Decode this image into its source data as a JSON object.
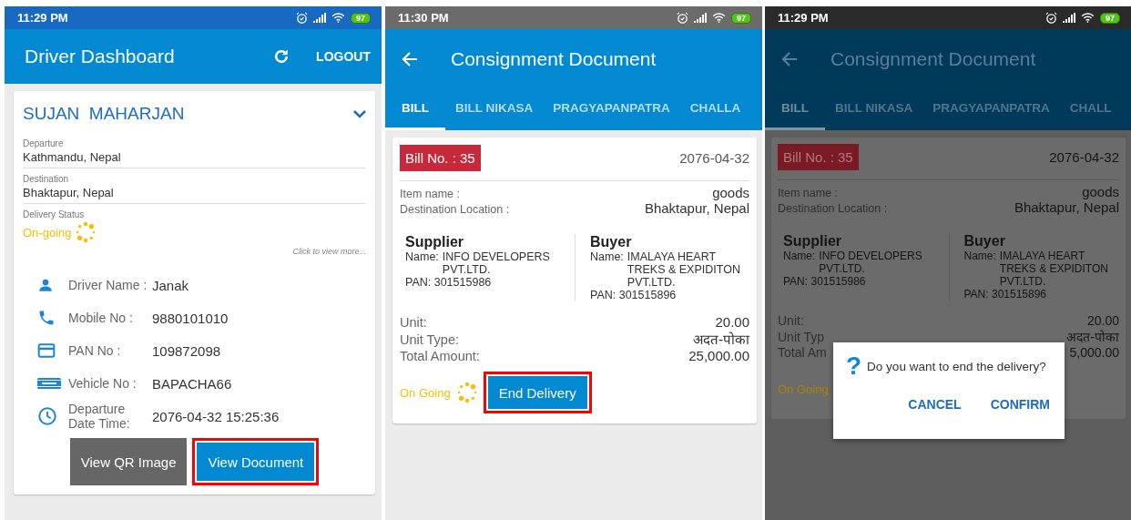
{
  "screens": [
    {
      "kind": "dashboard",
      "dimmed": false,
      "status_bar": {
        "time": "11:29 PM",
        "battery": "97"
      },
      "app_bar": {
        "title": "Driver Dashboard",
        "action": "LOGOUT"
      },
      "card": {
        "name": "SUJAN  MAHARJAN",
        "expanded": true,
        "fields": [
          {
            "label": "Departure",
            "value": "Kathmandu, Nepal"
          },
          {
            "label": "Destination",
            "value": "Bhaktapur, Nepal"
          }
        ],
        "status": {
          "label": "Delivery Status",
          "value": "On-going"
        },
        "more_link": "Click to view more...",
        "details": [
          {
            "kind": "person",
            "label": "Driver Name :",
            "value": "Janak"
          },
          {
            "kind": "phone",
            "label": "Mobile No :",
            "value": "9880101010"
          },
          {
            "kind": "card",
            "label": "PAN No :",
            "value": "109872098"
          },
          {
            "kind": "plate",
            "label": "Vehicle No :",
            "value": "BAPACHA66"
          },
          {
            "kind": "clock",
            "label": "Departure Date Time:",
            "value": "2076-04-32 15:25:36"
          }
        ],
        "buttons": [
          {
            "kind": "secondary",
            "label": "View QR Image",
            "highlighted": false
          },
          {
            "kind": "primary",
            "label": "View Document",
            "highlighted": true
          }
        ]
      }
    },
    {
      "kind": "document",
      "dimmed": false,
      "status_bar": {
        "time": "11:30 PM",
        "battery": "97"
      },
      "app_bar": {
        "title": "Consignment Document"
      },
      "tabs": [
        {
          "label": "BILL",
          "selected": true
        },
        {
          "label": "BILL NIKASA",
          "selected": false
        },
        {
          "label": "PRAGYAPANPATRA",
          "selected": false
        },
        {
          "label": "CHALLA",
          "selected": false
        }
      ],
      "bill": {
        "number": "Bill No. : 35",
        "date": "2076-04-32",
        "info": [
          {
            "label": "Item name :",
            "value": "goods"
          },
          {
            "label": "Destination Location :",
            "value": "Bhaktapur, Nepal"
          }
        ],
        "parties": [
          {
            "title": "Supplier",
            "name_label": "Name:",
            "name_lines": [
              "INFO DEVELOPERS",
              "PVT.LTD."
            ],
            "pan": "PAN: 301515986"
          },
          {
            "title": "Buyer",
            "name_label": "Name:",
            "name_lines": [
              "IMALAYA HEART",
              "TREKS & EXPIDITON",
              "PVT.LTD."
            ],
            "pan": "PAN: 301515896"
          }
        ],
        "amounts": [
          {
            "label": "Unit:",
            "value": "20.00"
          },
          {
            "label": "Unit Type:",
            "value": "अदत-पोका"
          },
          {
            "label": "Total Amount:",
            "value": "25,000.00"
          }
        ],
        "status": "On Going",
        "spinner": true,
        "button": {
          "label": "End Delivery",
          "highlighted": true
        }
      }
    },
    {
      "kind": "document",
      "dimmed": true,
      "status_bar": {
        "time": "11:29 PM",
        "battery": "97"
      },
      "app_bar": {
        "title": "Consignment Document"
      },
      "tabs": [
        {
          "label": "BILL",
          "selected": true
        },
        {
          "label": "BILL NIKASA",
          "selected": false
        },
        {
          "label": "PRAGYAPANPATRA",
          "selected": false
        },
        {
          "label": "CHALL",
          "selected": false
        }
      ],
      "bill": {
        "number": "Bill No. : 35",
        "date": "2076-04-32",
        "info": [
          {
            "label": "Item name :",
            "value": "goods"
          },
          {
            "label": "Destination Location :",
            "value": "Bhaktapur, Nepal"
          }
        ],
        "parties": [
          {
            "title": "Supplier",
            "name_label": "Name:",
            "name_lines": [
              "INFO DEVELOPERS",
              "PVT.LTD."
            ],
            "pan": "PAN: 301515986"
          },
          {
            "title": "Buyer",
            "name_label": "Name:",
            "name_lines": [
              "IMALAYA HEART",
              "TREKS & EXPIDITON",
              "PVT.LTD."
            ],
            "pan": "PAN: 301515896"
          }
        ],
        "amounts": [
          {
            "label": "Unit:",
            "value": "20.00"
          },
          {
            "label": "Unit Typ",
            "value": "अदत-पोका"
          },
          {
            "label": "Total Am",
            "value": "5,000.00"
          }
        ],
        "status": "On Going",
        "spinner": false
      },
      "dialog": {
        "icon": "?",
        "message": "Do you want to end the delivery?",
        "buttons": [
          "CANCEL",
          "CONFIRM"
        ]
      }
    }
  ]
}
